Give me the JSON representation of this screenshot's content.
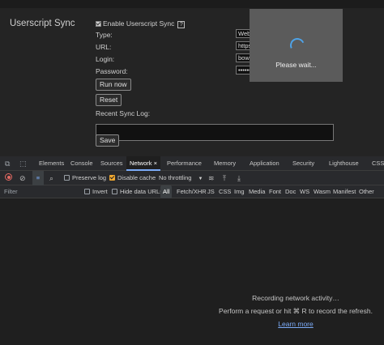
{
  "settings": {
    "section_title": "Userscript Sync",
    "enable_label": "Enable Userscript Sync",
    "help_glyph": "?",
    "type_label": "Type:",
    "type_value": "Webd",
    "url_label": "URL:",
    "url_value": "https",
    "login_label": "Login:",
    "login_value": "bowe",
    "password_label": "Password:",
    "password_value": "•••••••",
    "run_now_label": "Run now",
    "reset_label": "Reset",
    "log_label": "Recent Sync Log:",
    "save_label": "Save"
  },
  "overlay": {
    "message": "Please wait..."
  },
  "devtools": {
    "tabs": [
      "Elements",
      "Console",
      "Sources",
      "Network",
      "Performance",
      "Memory",
      "Application",
      "Security",
      "Lighthouse",
      "CSS"
    ],
    "active_tab": "Network",
    "close_glyph": "×",
    "toolbar": {
      "preserve_log": "Preserve log",
      "disable_cache": "Disable cache",
      "throttling": "No throttling",
      "dropdown_glyph": "▼"
    },
    "filter": {
      "placeholder": "Filter",
      "invert": "Invert",
      "hide_data_urls": "Hide data URLs",
      "types": [
        "All",
        "Fetch/XHR",
        "JS",
        "CSS",
        "Img",
        "Media",
        "Font",
        "Doc",
        "WS",
        "Wasm",
        "Manifest",
        "Other"
      ]
    },
    "empty_state": {
      "line1": "Recording network activity…",
      "line2": "Perform a request or hit ⌘ R to record the refresh.",
      "link": "Learn more"
    }
  }
}
